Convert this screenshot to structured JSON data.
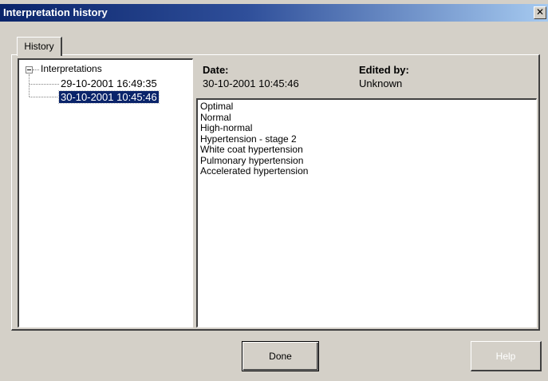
{
  "window": {
    "title": "Interpretation history",
    "close_label": "✕"
  },
  "tabs": [
    {
      "label": "History"
    }
  ],
  "tree": {
    "root_label": "Interpretations",
    "expander": "−",
    "items": [
      {
        "label": "29-10-2001 16:49:35",
        "selected": false
      },
      {
        "label": "30-10-2001 10:45:46",
        "selected": true
      }
    ]
  },
  "details": {
    "date_label": "Date:",
    "date_value": "30-10-2001 10:45:46",
    "edited_by_label": "Edited by:",
    "edited_by_value": "Unknown"
  },
  "interpretation_lines": [
    "Optimal",
    "Normal",
    "High-normal",
    "Hypertension - stage 2",
    "White coat hypertension",
    "Pulmonary hypertension",
    "Accelerated hypertension"
  ],
  "buttons": {
    "done_label": "Done",
    "help_label": "Help"
  },
  "colors": {
    "selection": "#0a246a",
    "titlebar_start": "#0a246a",
    "titlebar_end": "#a6caf0",
    "face": "#d4d0c8"
  }
}
